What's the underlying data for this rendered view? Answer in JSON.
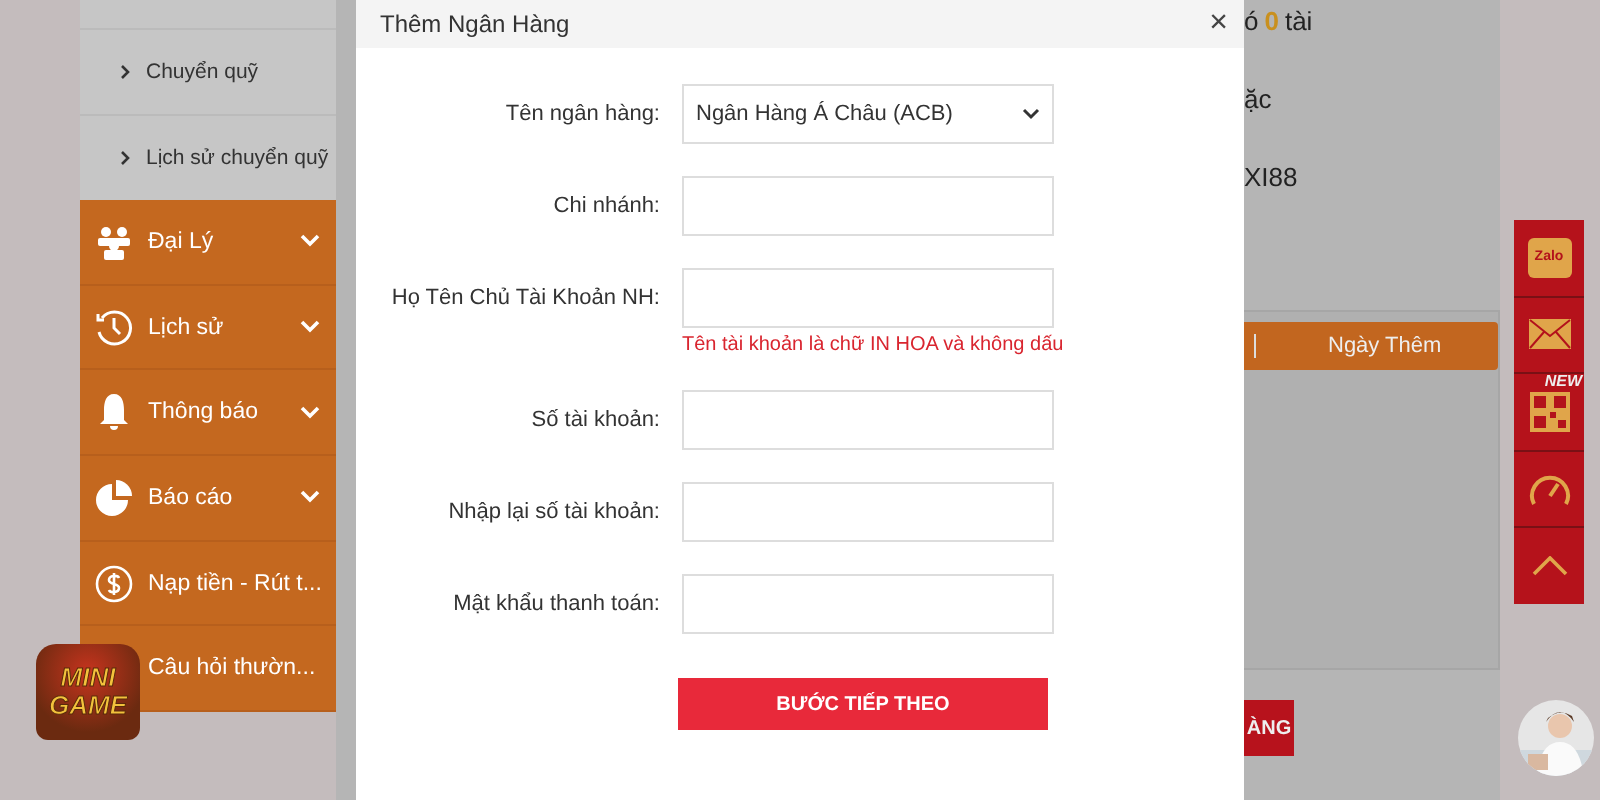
{
  "background": {
    "balance_prefix": "ó",
    "balance_count": "0",
    "balance_suffix": "tài",
    "line_2": "ặc",
    "line_3": "XI88",
    "table_header": "Ngày Thêm",
    "button": "ÀNG"
  },
  "sidebar": {
    "subitems": [
      "Chuyển quỹ",
      "Lịch sử chuyển quỹ"
    ],
    "items": [
      {
        "label": "Đại Lý",
        "kind": "agent"
      },
      {
        "label": "Lịch sử",
        "kind": "history"
      },
      {
        "label": "Thông báo",
        "kind": "bell"
      },
      {
        "label": "Báo cáo",
        "kind": "report"
      },
      {
        "label": "Nạp tiền - Rút t...",
        "kind": "money"
      },
      {
        "label": "Câu hỏi thườn...",
        "kind": "faq"
      }
    ]
  },
  "logo": {
    "line_1": "MINI",
    "line_2": "GAME"
  },
  "modal": {
    "title": "Thêm Ngân Hàng",
    "close": "×",
    "fields": [
      {
        "label": "Tên ngân hàng:",
        "kind": "select",
        "value": "Ngân Hàng Á Châu (ACB)"
      },
      {
        "label": "Chi nhánh:",
        "kind": "text"
      },
      {
        "label": "Họ Tên Chủ Tài Khoản NH:",
        "kind": "text",
        "hint": "Tên tài khoản là chữ IN HOA và không dấu"
      },
      {
        "label": "Số tài khoản:",
        "kind": "text"
      },
      {
        "label": "Nhập lại số tài khoản:",
        "kind": "text"
      },
      {
        "label": "Mật khẩu thanh toán:",
        "kind": "text"
      }
    ],
    "submit": "BƯỚC TIẾP THEO"
  },
  "toolbar": [
    {
      "kind": "zalo",
      "label": "Zalo"
    },
    {
      "kind": "mail"
    },
    {
      "kind": "qr",
      "badge": "NEW"
    },
    {
      "kind": "speed"
    },
    {
      "kind": "top"
    }
  ]
}
